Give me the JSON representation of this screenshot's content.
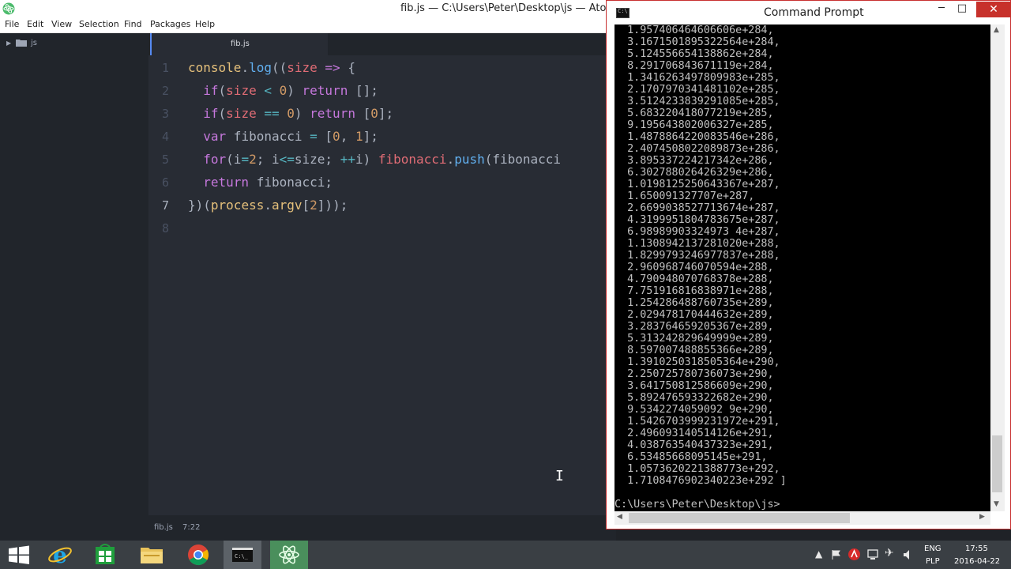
{
  "atom": {
    "title": "fib.js — C:\\Users\\Peter\\Desktop\\js — Atom",
    "menu": [
      "File",
      "Edit",
      "View",
      "Selection",
      "Find",
      "Packages",
      "Help"
    ],
    "tree_root": "js",
    "tab_label": "fib.js",
    "line_numbers": [
      "1",
      "2",
      "3",
      "4",
      "5",
      "6",
      "7",
      "8"
    ],
    "status_file": "fib.js",
    "status_cursor": "7:22"
  },
  "cmd": {
    "title": "Command Prompt",
    "minimize": "─",
    "maximize": "□",
    "close": "✕",
    "output_lines": [
      "  1.957406464606606e+284,",
      "  3.1671501895322564e+284,",
      "  5.124556654138862e+284,",
      "  8.291706843671119e+284,",
      "  1.3416263497809983e+285,",
      "  2.1707970341481102e+285,",
      "  3.5124233839291085e+285,",
      "  5.683220418077219e+285,",
      "  9.195643802006327e+285,",
      "  1.4878864220083546e+286,",
      "  2.4074508022089873e+286,",
      "  3.895337224217342e+286,",
      "  6.302788026426329e+286,",
      "  1.0198125250643367e+287,",
      "  1.650091327707e+287,",
      "  2.6699038527713674e+287,",
      "  4.3199951804783675e+287,",
      "  6.98989903324973 4e+287,",
      "  1.1308942137281020e+288,",
      "  1.8299793246977837e+288,",
      "  2.960968746070594e+288,",
      "  4.790948070768378e+288,",
      "  7.751916816838971e+288,",
      "  1.254286488760735e+289,",
      "  2.029478170444632e+289,",
      "  3.283764659205367e+289,",
      "  5.313242829649999e+289,",
      "  8.597007488855366e+289,",
      "  1.3910250318505364e+290,",
      "  2.250725780736073e+290,",
      "  3.641750812586609e+290,",
      "  5.892476593322682e+290,",
      "  9.5342274059092 9e+290,",
      "  1.5426703999231972e+291,",
      "  2.496093140514126e+291,",
      "  4.038763540437323e+291,",
      "  6.53485668095145e+291,",
      "  1.0573620221388773e+292,",
      "  1.7108476902340223e+292 ]",
      "",
      "C:\\Users\\Peter\\Desktop\\js>"
    ]
  },
  "taskbar": {
    "lang_top": "ENG",
    "lang_bottom": "PLP",
    "time": "17:55",
    "date": "2016-04-22"
  },
  "icons": [
    "atom-logo-icon",
    "folder-icon",
    "windows-start-icon",
    "internet-explorer-icon",
    "store-icon",
    "file-explorer-icon",
    "chrome-icon",
    "cmd-icon",
    "atom-icon"
  ],
  "colors": {
    "editor_bg": "#282c34",
    "keyword": "#c678dd",
    "function": "#61afef",
    "number": "#d19a66",
    "cmd_close": "#c7312b"
  }
}
